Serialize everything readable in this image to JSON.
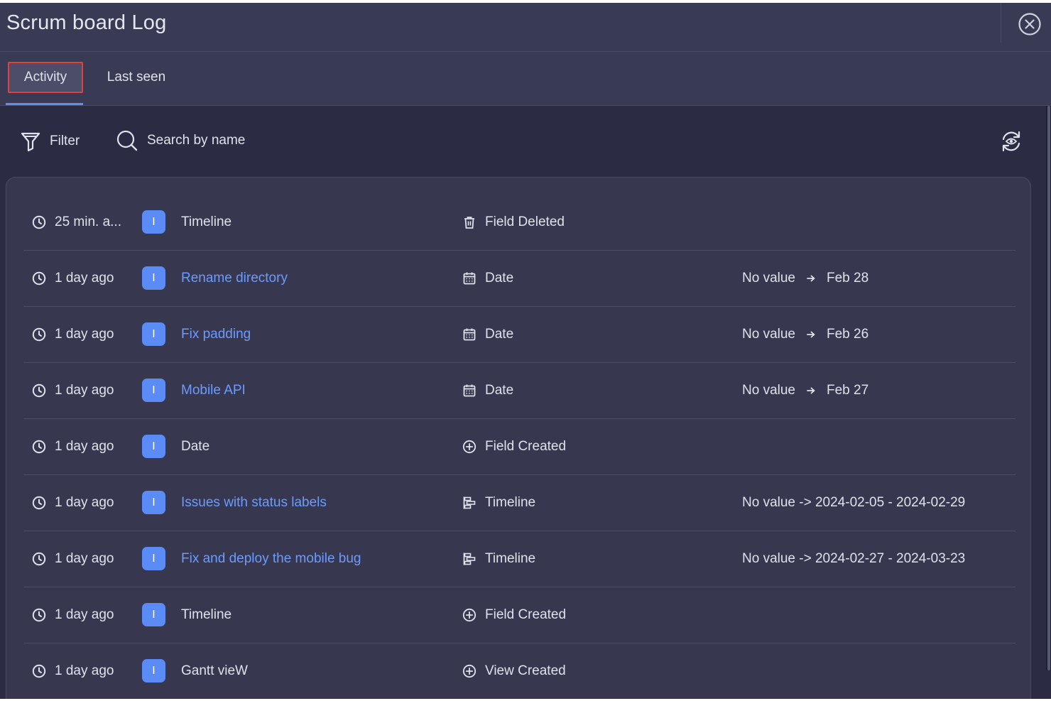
{
  "header": {
    "title": "Scrum board Log"
  },
  "tabs": [
    {
      "label": "Activity",
      "active": true
    },
    {
      "label": "Last seen",
      "active": false
    }
  ],
  "toolbar": {
    "filter_label": "Filter",
    "search_placeholder": "Search by name"
  },
  "colors": {
    "accent": "#5b8cf5",
    "link": "#6b9bff",
    "highlight_border": "#e0413c"
  },
  "rows": [
    {
      "time": "25 min. a...",
      "avatar": "I",
      "item": "Timeline",
      "item_link": false,
      "field_icon": "trash-icon",
      "field": "Field Deleted",
      "change_from": "",
      "change_to": "",
      "change_text": ""
    },
    {
      "time": "1 day ago",
      "avatar": "I",
      "item": "Rename directory",
      "item_link": true,
      "field_icon": "calendar-icon",
      "field": "Date",
      "change_from": "No value",
      "change_to": "Feb 28",
      "change_text": ""
    },
    {
      "time": "1 day ago",
      "avatar": "I",
      "item": "Fix padding",
      "item_link": true,
      "field_icon": "calendar-icon",
      "field": "Date",
      "change_from": "No value",
      "change_to": "Feb 26",
      "change_text": ""
    },
    {
      "time": "1 day ago",
      "avatar": "I",
      "item": "Mobile API",
      "item_link": true,
      "field_icon": "calendar-icon",
      "field": "Date",
      "change_from": "No value",
      "change_to": "Feb 27",
      "change_text": ""
    },
    {
      "time": "1 day ago",
      "avatar": "I",
      "item": "Date",
      "item_link": false,
      "field_icon": "plus-circle-icon",
      "field": "Field Created",
      "change_from": "",
      "change_to": "",
      "change_text": ""
    },
    {
      "time": "1 day ago",
      "avatar": "I",
      "item": "Issues with status labels",
      "item_link": true,
      "field_icon": "timeline-icon",
      "field": "Timeline",
      "change_from": "",
      "change_to": "",
      "change_text": "No value -> 2024-02-05 - 2024-02-29"
    },
    {
      "time": "1 day ago",
      "avatar": "I",
      "item": "Fix and deploy the mobile bug",
      "item_link": true,
      "field_icon": "timeline-icon",
      "field": "Timeline",
      "change_from": "",
      "change_to": "",
      "change_text": "No value -> 2024-02-27 - 2024-03-23"
    },
    {
      "time": "1 day ago",
      "avatar": "I",
      "item": "Timeline",
      "item_link": false,
      "field_icon": "plus-circle-icon",
      "field": "Field Created",
      "change_from": "",
      "change_to": "",
      "change_text": ""
    },
    {
      "time": "1 day ago",
      "avatar": "I",
      "item": "Gantt vieW",
      "item_link": false,
      "field_icon": "plus-circle-icon",
      "field": "View Created",
      "change_from": "",
      "change_to": "",
      "change_text": ""
    }
  ]
}
